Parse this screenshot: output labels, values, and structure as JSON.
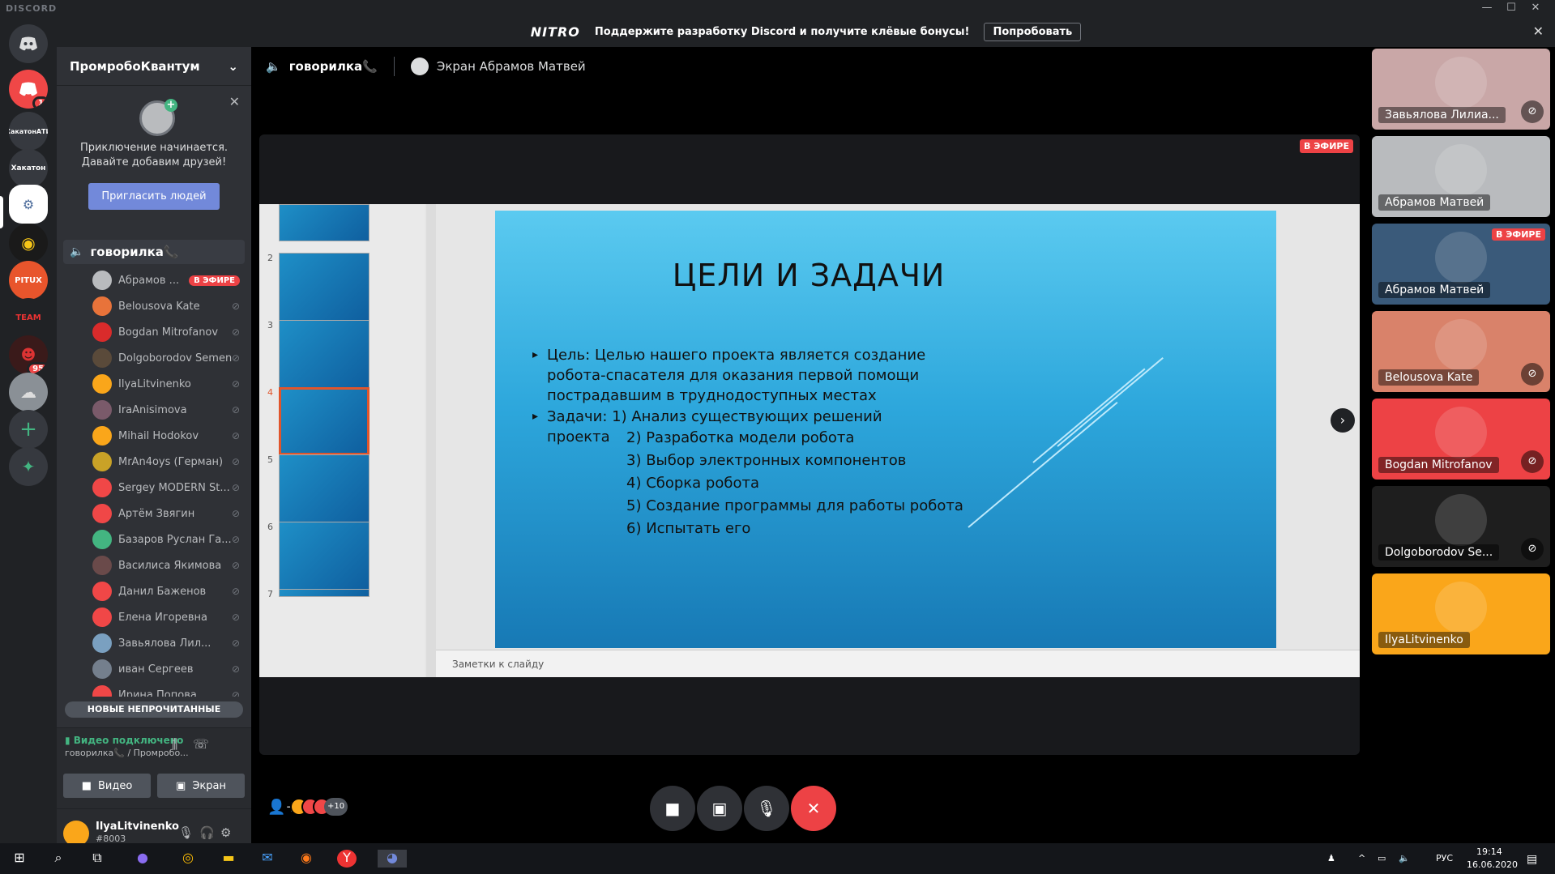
{
  "window": {
    "brand": "DISCORD",
    "minimize": "—",
    "maximize": "☐",
    "close": "✕"
  },
  "nitro": {
    "logo": "NITRO",
    "message": "Поддержите разработку Discord и получите клёвые бонусы!",
    "button": "Попробовать",
    "close": "✕"
  },
  "servers": {
    "home_badge": "1",
    "hackathon_ati": "ХакатонАТИ",
    "hackathon": "Хакатон",
    "pitux": "PITUX",
    "team": "TEAM",
    "red_badge": "95"
  },
  "sidebar": {
    "guild_name": "ПромробоКвантум",
    "invite_text_1": "Приключение начинается.",
    "invite_text_2": "Давайте добавим друзей!",
    "invite_button": "Пригласить людей",
    "voice_channel": "говорилка📞",
    "live_badge": "В ЭФИРЕ",
    "users": [
      {
        "name": "Абрамов ...",
        "live": true,
        "color": "#b9bbbe"
      },
      {
        "name": "Belousova Kate",
        "live": false,
        "color": "#e8733a"
      },
      {
        "name": "Bogdan Mitrofanov",
        "live": false,
        "color": "#d92b2b"
      },
      {
        "name": "Dolgoborodov Semen",
        "live": false,
        "color": "#5a4a3a"
      },
      {
        "name": "IlyaLitvinenko",
        "live": false,
        "color": "#faa61a"
      },
      {
        "name": "IraAnisimova",
        "live": false,
        "color": "#7a5a6a"
      },
      {
        "name": "Mihail Hodokov",
        "live": false,
        "color": "#faa61a"
      },
      {
        "name": "MrAn4oys (Герман)",
        "live": false,
        "color": "#c9a227"
      },
      {
        "name": "Sergey MODERN St...",
        "live": false,
        "color": "#f04747"
      },
      {
        "name": "Артём Звягин",
        "live": false,
        "color": "#f04747"
      },
      {
        "name": "Базаров Руслан Га...",
        "live": false,
        "color": "#43b581"
      },
      {
        "name": "Василиса Якимова",
        "live": false,
        "color": "#6a4a4a"
      },
      {
        "name": "Данил Баженов",
        "live": false,
        "color": "#f04747"
      },
      {
        "name": "Елена Игоревна",
        "live": false,
        "color": "#f04747"
      },
      {
        "name": "Завьялова Лил...",
        "live": false,
        "color": "#7aa0c0"
      },
      {
        "name": "иван Сергеев",
        "live": false,
        "color": "#747f8d"
      },
      {
        "name": "Ирина Попова",
        "live": false,
        "color": "#f04747"
      }
    ],
    "unread": "НОВЫЕ НЕПРОЧИТАННЫЕ",
    "voice_status": "Видео подключено",
    "voice_sub": "говорилка📞 / Промробо...",
    "video_btn": "Видео",
    "screen_btn": "Экран",
    "username": "IlyaLitvinenko",
    "usertag": "#8003"
  },
  "main": {
    "channel": "говорилка📞",
    "screen_label": "Экран Абрамов Матвей",
    "live": "В ЭФИРЕ",
    "thumb_numbers": [
      "2",
      "3",
      "4",
      "5",
      "6",
      "7"
    ],
    "slide_title": "ЦЕЛИ И ЗАДАЧИ",
    "goal": "Цель: Целью нашего проекта является создание робота-спасателя для оказания первой помощи пострадавшим в труднодоступных местах",
    "tasks_head": "Задачи: 1) Анализ существующих решений проекта",
    "tasks": [
      "2) Разработка модели робота",
      "3) Выбор электронных компонентов",
      "4) Сборка робота",
      "5) Создание программы для работы робота",
      "6) Испытать его"
    ],
    "notes": "Заметки к слайду",
    "more_participants": "+10"
  },
  "tiles": [
    {
      "name": "Завьялова Лилиа...",
      "bg": "#c9a7a7",
      "muted": true
    },
    {
      "name": "Абрамов Матвей",
      "bg": "#b9bbbe",
      "muted": false
    },
    {
      "name": "Абрамов Матвей",
      "bg": "#3a5a7a",
      "muted": false,
      "live": "В ЭФИРЕ"
    },
    {
      "name": "Belousova Kate",
      "bg": "#d9826a",
      "muted": true
    },
    {
      "name": "Bogdan Mitrofanov",
      "bg": "#ed4245",
      "muted": true
    },
    {
      "name": "Dolgoborodov Se...",
      "bg": "#1e1e1e",
      "muted": true
    },
    {
      "name": "IlyaLitvinenko",
      "bg": "#faa61a",
      "muted": false
    }
  ],
  "taskbar": {
    "lang": "РУС",
    "time": "19:14",
    "date": "16.06.2020"
  }
}
